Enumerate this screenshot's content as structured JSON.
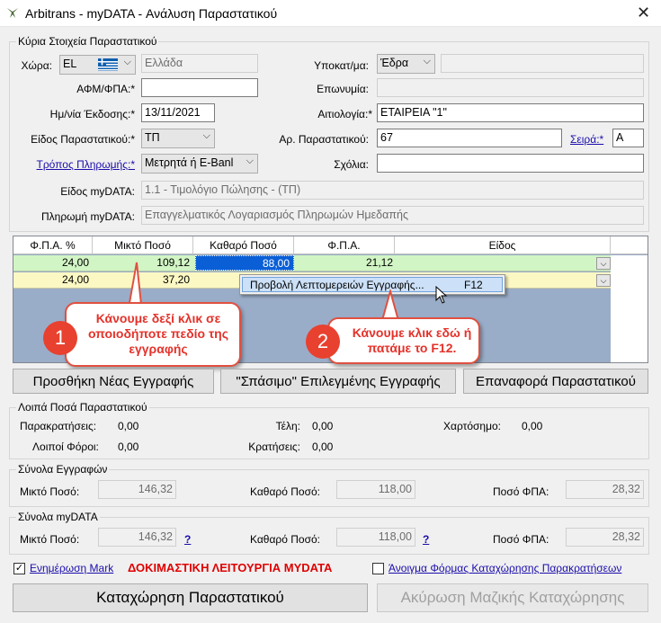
{
  "window": {
    "title": "Arbitrans - myDATA - Ανάλυση Παραστατικού"
  },
  "main_group": {
    "label": "Κύρια Στοιχεία Παραστατικού",
    "country_label": "Χώρα:",
    "country_code": "EL",
    "country_name": "Ελλάδα",
    "afm_label": "ΑΦΜ/ΦΠΑ:*",
    "afm_value": "",
    "issue_date_label": "Ημ/νία Έκδοσης:*",
    "issue_date": "13/11/2021",
    "doc_type_label": "Είδος Παραστατικού:*",
    "doc_type": "ΤΠ",
    "payment_method_label": "Τρόπος Πληρωμής:*",
    "payment_method": "Μετρητά ή E-Banl",
    "subsidiary_label": "Υποκατ/μα:",
    "subsidiary": "Έδρα",
    "name_label": "Επωνυμία:",
    "reason_label": "Αιτιολογία:*",
    "reason": "ΕΤΑΙΡΕΙΑ \"1\"",
    "doc_number_label": "Αρ. Παραστατικού:",
    "doc_number": "67",
    "series_label": "Σειρά:*",
    "series": "Α",
    "comments_label": "Σχόλια:",
    "mydata_type_label": "Είδος myDATA:",
    "mydata_type": "1.1 - Τιμολόγιο Πώλησης - (ΤΠ)",
    "mydata_payment_label": "Πληρωμή myDATA:",
    "mydata_payment": "Επαγγελματικός Λογαριασμός Πληρωμών Ημεδαπής"
  },
  "grid": {
    "headers": [
      "Φ.Π.Α. %",
      "Μικτό Ποσό",
      "Καθαρό Ποσό",
      "Φ.Π.Α.",
      "Είδος"
    ],
    "rows": [
      {
        "vat_pct": "24,00",
        "gross": "109,12",
        "net": "88,00",
        "vat": "21,12"
      },
      {
        "vat_pct": "24,00",
        "gross": "37,20",
        "net": "",
        "vat": ""
      }
    ]
  },
  "context_menu": {
    "item": "Προβολή Λεπτομερειών Εγγραφής...",
    "shortcut": "F12"
  },
  "callouts": [
    {
      "number": "1",
      "text": "Κάνουμε δεξί κλικ σε οποιοδήποτε πεδίο της εγγραφής"
    },
    {
      "number": "2",
      "text": "Κάνουμε κλικ εδώ ή πατάμε το F12."
    }
  ],
  "buttons": {
    "add_row": "Προσθήκη Νέας Εγγραφής",
    "split_row": "\"Σπάσιμο\" Επιλεγμένης Εγγραφής",
    "reset_doc": "Επαναφορά Παραστατικού",
    "save": "Καταχώρηση Παραστατικού",
    "cancel_bulk": "Ακύρωση Μαζικής Καταχώρησης"
  },
  "other_amounts": {
    "label": "Λοιπά Ποσά Παραστατικού",
    "withholdings_label": "Παρακρατήσεις:",
    "withholdings": "0,00",
    "fees_label": "Τέλη:",
    "fees": "0,00",
    "stamp_label": "Χαρτόσημο:",
    "stamp": "0,00",
    "other_taxes_label": "Λοιποί Φόροι:",
    "other_taxes": "0,00",
    "deductions_label": "Κρατήσεις:",
    "deductions": "0,00"
  },
  "row_totals": {
    "label": "Σύνολα Εγγραφών",
    "gross_label": "Μικτό Ποσό:",
    "gross": "146,32",
    "net_label": "Καθαρό Ποσό:",
    "net": "118,00",
    "vat_label": "Ποσό ΦΠΑ:",
    "vat": "28,32"
  },
  "mydata_totals": {
    "label": "Σύνολα myDATA",
    "gross_label": "Μικτό Ποσό:",
    "gross": "146,32",
    "net_label": "Καθαρό Ποσό:",
    "net": "118,00",
    "vat_label": "Ποσό ΦΠΑ:",
    "vat": "28,32",
    "help": "?"
  },
  "footer": {
    "update_mark": "Ενημέρωση Mark",
    "test_mode": "ΔΟΚΙΜΑΣΤΙΚΗ ΛΕΙΤΟΥΡΓΙΑ MYDATA",
    "open_withholdings": "Άνοιγμα Φόρμας Καταχώρησης Παρακρατήσεων"
  },
  "colors": {
    "accent_red": "#e4322a",
    "grid_blue": "#9aadc8",
    "row_green": "#d1f5c4",
    "row_yellow": "#fcf8c4",
    "selected_cell": "#0a5fd6"
  }
}
